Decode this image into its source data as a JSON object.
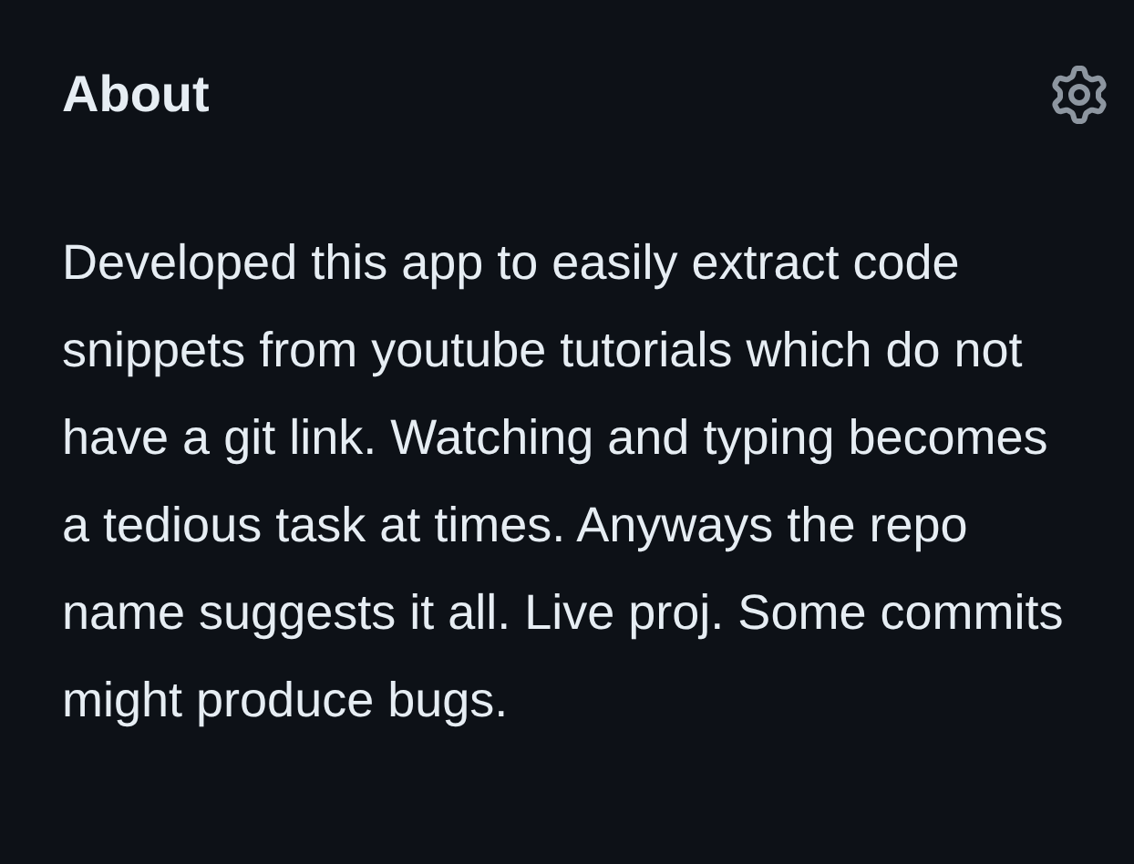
{
  "about": {
    "title": "About",
    "description": "Developed this app to easily extract code snippets from youtube tutorials which do not have a git link. Watching and typing becomes a tedious task at times. Anyways the repo name suggests it all. Live proj. Some commits might produce bugs."
  }
}
